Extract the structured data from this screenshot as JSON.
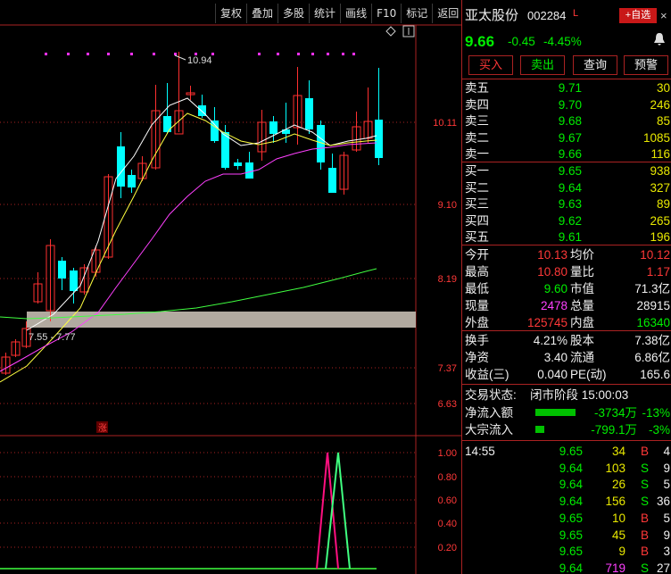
{
  "toolbar": {
    "items": [
      "复权",
      "叠加",
      "多股",
      "统计",
      "画线",
      "F10",
      "标记",
      "返回"
    ]
  },
  "chart": {
    "price_labels": [
      "10.11",
      "9.10",
      "8.19",
      "7.37",
      "6.63"
    ],
    "high_annotation": "10.94",
    "zone_label": "7.55 - 7.77",
    "zhang_label": "涨",
    "indicator_labels": [
      "1.00",
      "0.80",
      "0.60",
      "0.40",
      "0.20"
    ],
    "colors": {
      "up": "#ff3030",
      "down": "#00ffff",
      "ma5": "#ffffff",
      "ma10": "#ffff40",
      "ma20": "#ff40ff",
      "ma60": "#40ff40",
      "zone": "#b2aaa0",
      "indicator1": "#ff1080",
      "indicator2": "#40ff80"
    }
  },
  "stock": {
    "name": "亚太股份",
    "code": "002284",
    "flag": "L",
    "add_label": "+自选",
    "price": "9.66",
    "change": "-0.45",
    "change_pct": "-4.45%"
  },
  "actions": {
    "buy": "买入",
    "sell": "卖出",
    "query": "查询",
    "alert": "预警"
  },
  "asks": [
    {
      "label": "卖五",
      "price": "9.71",
      "vol": "30"
    },
    {
      "label": "卖四",
      "price": "9.70",
      "vol": "246"
    },
    {
      "label": "卖三",
      "price": "9.68",
      "vol": "85"
    },
    {
      "label": "卖二",
      "price": "9.67",
      "vol": "1085"
    },
    {
      "label": "卖一",
      "price": "9.66",
      "vol": "116"
    }
  ],
  "bids": [
    {
      "label": "买一",
      "price": "9.65",
      "vol": "938"
    },
    {
      "label": "买二",
      "price": "9.64",
      "vol": "327"
    },
    {
      "label": "买三",
      "price": "9.63",
      "vol": "89"
    },
    {
      "label": "买四",
      "price": "9.62",
      "vol": "265"
    },
    {
      "label": "买五",
      "price": "9.61",
      "vol": "196"
    }
  ],
  "stats1": [
    {
      "l1": "今开",
      "v1": "10.13",
      "c1": "red",
      "l2": "均价",
      "v2": "10.12",
      "c2": "red"
    },
    {
      "l1": "最高",
      "v1": "10.80",
      "c1": "red",
      "l2": "量比",
      "v2": "1.17",
      "c2": "red"
    },
    {
      "l1": "最低",
      "v1": "9.60",
      "c1": "green",
      "l2": "市值",
      "v2": "71.3亿",
      "c2": "white"
    },
    {
      "l1": "现量",
      "v1": "2478",
      "c1": "magenta",
      "l2": "总量",
      "v2": "28915",
      "c2": "white"
    },
    {
      "l1": "外盘",
      "v1": "125745",
      "c1": "red",
      "l2": "内盘",
      "v2": "16340",
      "c2": "green"
    }
  ],
  "stats2": [
    {
      "l1": "换手",
      "v1": "4.21%",
      "l2": "股本",
      "v2": "7.38亿"
    },
    {
      "l1": "净资",
      "v1": "3.40",
      "l2": "流通",
      "v2": "6.86亿"
    },
    {
      "l1": "收益(三)",
      "v1": "0.040",
      "l2": "PE(动)",
      "v2": "165.6"
    }
  ],
  "status": {
    "label": "交易状态:",
    "value": "闭市阶段 15:00:03"
  },
  "flows": [
    {
      "label": "净流入额",
      "amount": "-3734万",
      "pct": "-13%",
      "bar_fraction": 0.68
    },
    {
      "label": "大宗流入",
      "amount": "-799.1万",
      "pct": "-3%",
      "bar_fraction": 0.15
    }
  ],
  "ticks": [
    {
      "time": "14:55",
      "price": "9.65",
      "vol": "34",
      "side": "B",
      "n": "4"
    },
    {
      "time": "",
      "price": "9.64",
      "vol": "103",
      "side": "S",
      "n": "9"
    },
    {
      "time": "",
      "price": "9.64",
      "vol": "26",
      "side": "S",
      "n": "5"
    },
    {
      "time": "",
      "price": "9.64",
      "vol": "156",
      "side": "S",
      "n": "36"
    },
    {
      "time": "",
      "price": "9.65",
      "vol": "10",
      "side": "B",
      "n": "5"
    },
    {
      "time": "",
      "price": "9.65",
      "vol": "45",
      "side": "B",
      "n": "9"
    },
    {
      "time": "",
      "price": "9.65",
      "vol": "9",
      "side": "B",
      "n": "3"
    },
    {
      "time": "",
      "price": "9.64",
      "vol": "719",
      "side": "S",
      "n": "27"
    }
  ]
}
